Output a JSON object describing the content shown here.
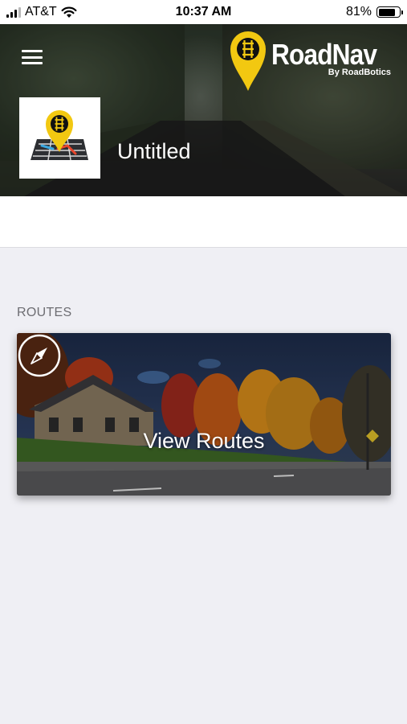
{
  "status_bar": {
    "carrier": "AT&T",
    "time": "10:37 AM",
    "battery_percent": "81%",
    "battery_level": 0.81,
    "icons": [
      "signal-icon",
      "wifi-icon",
      "battery-icon"
    ]
  },
  "header": {
    "brand_name": "RoadNav",
    "brand_subtitle": "By RoadBotics",
    "project_title": "Untitled",
    "icons": [
      "menu-icon",
      "roadnav-pin-logo",
      "project-map-icon"
    ]
  },
  "routes_section": {
    "heading": "ROUTES",
    "card_label": "View Routes",
    "card_icon": "compass-icon"
  },
  "colors": {
    "brand_yellow": "#f2c811",
    "background": "#efeff4",
    "heading_gray": "#6d6d72"
  }
}
